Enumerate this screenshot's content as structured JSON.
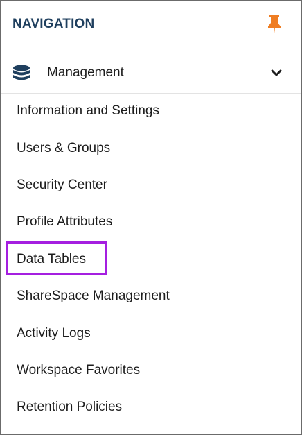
{
  "navigation": {
    "title": "NAVIGATION",
    "pin_icon": "pushpin-icon",
    "title_color": "#1f3f5e",
    "pin_color": "#ef7d22"
  },
  "section": {
    "label": "Management",
    "icon": "database-icon",
    "expand_icon": "chevron-down-icon",
    "expanded": true
  },
  "menu": {
    "items": [
      {
        "label": "Information and Settings"
      },
      {
        "label": "Users & Groups"
      },
      {
        "label": "Security Center"
      },
      {
        "label": "Profile Attributes"
      },
      {
        "label": "Data Tables",
        "highlighted": true
      },
      {
        "label": "ShareSpace Management"
      },
      {
        "label": "Activity Logs"
      },
      {
        "label": "Workspace Favorites"
      },
      {
        "label": "Retention Policies"
      }
    ]
  },
  "highlight_color": "#a51fe0"
}
